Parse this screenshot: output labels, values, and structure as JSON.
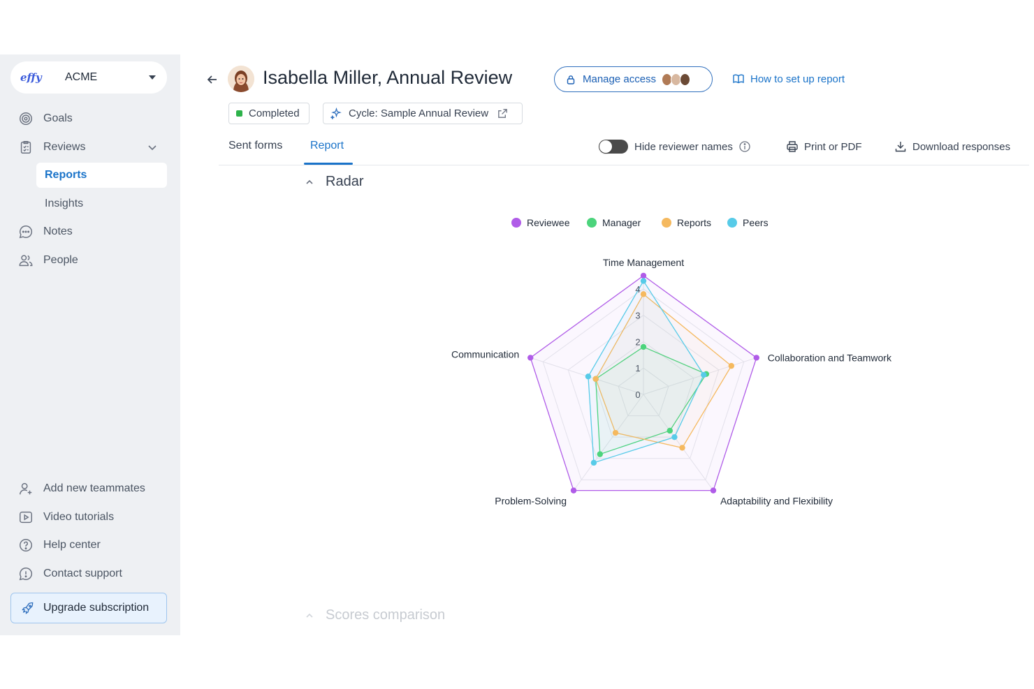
{
  "sidebar": {
    "org": {
      "logo": "effy",
      "name": "ACME"
    },
    "items": [
      {
        "label": "Goals",
        "icon": "target-icon"
      },
      {
        "label": "Reviews",
        "icon": "clipboard-icon"
      },
      {
        "label": "Notes",
        "icon": "chat-bubble-icon"
      },
      {
        "label": "People",
        "icon": "people-icon"
      }
    ],
    "sub_items": [
      {
        "label": "Reports",
        "active": true
      },
      {
        "label": "Insights",
        "active": false
      }
    ],
    "footer_items": [
      {
        "label": "Add new teammates",
        "icon": "add-user-icon"
      },
      {
        "label": "Video tutorials",
        "icon": "play-icon"
      },
      {
        "label": "Help center",
        "icon": "help-icon"
      },
      {
        "label": "Contact support",
        "icon": "support-icon"
      }
    ],
    "upgrade_label": "Upgrade subscription"
  },
  "header": {
    "title": "Isabella Miller,  Annual Review",
    "manage_access": "Manage access",
    "how_to": "How to set up report",
    "status": "Completed",
    "cycle": "Cycle: Sample Annual Review"
  },
  "tabs": [
    {
      "label": "Sent forms",
      "active": false
    },
    {
      "label": "Report",
      "active": true
    }
  ],
  "toolbar": {
    "hide_names": "Hide reviewer names",
    "hide_names_on": false,
    "print": "Print or PDF",
    "download": "Download responses"
  },
  "sections": {
    "radar": "Radar",
    "scores": "Scores comparison"
  },
  "colors": {
    "accent": "#1a73c9",
    "reviewee": "#b05ce8",
    "manager": "#4cd47c",
    "reports": "#f5b95f",
    "peers": "#57cbe8"
  },
  "chart_data": {
    "type": "radar",
    "categories": [
      "Time Management",
      "Collaboration and Teamwork",
      "Adaptability and Flexibility",
      "Problem-Solving",
      "Communication"
    ],
    "rlim": [
      0,
      4
    ],
    "ticks": [
      "0",
      "1",
      "2",
      "3",
      "4"
    ],
    "legend_position": "top",
    "series": [
      {
        "name": "Reviewee",
        "values": [
          4.5,
          4.5,
          4.5,
          4.5,
          4.5
        ]
      },
      {
        "name": "Manager",
        "values": [
          1.8,
          2.5,
          1.7,
          2.8,
          1.9
        ]
      },
      {
        "name": "Reports",
        "values": [
          3.8,
          3.5,
          2.5,
          1.8,
          1.9
        ]
      },
      {
        "name": "Peers",
        "values": [
          4.3,
          2.4,
          2.0,
          3.2,
          2.2
        ]
      }
    ]
  }
}
